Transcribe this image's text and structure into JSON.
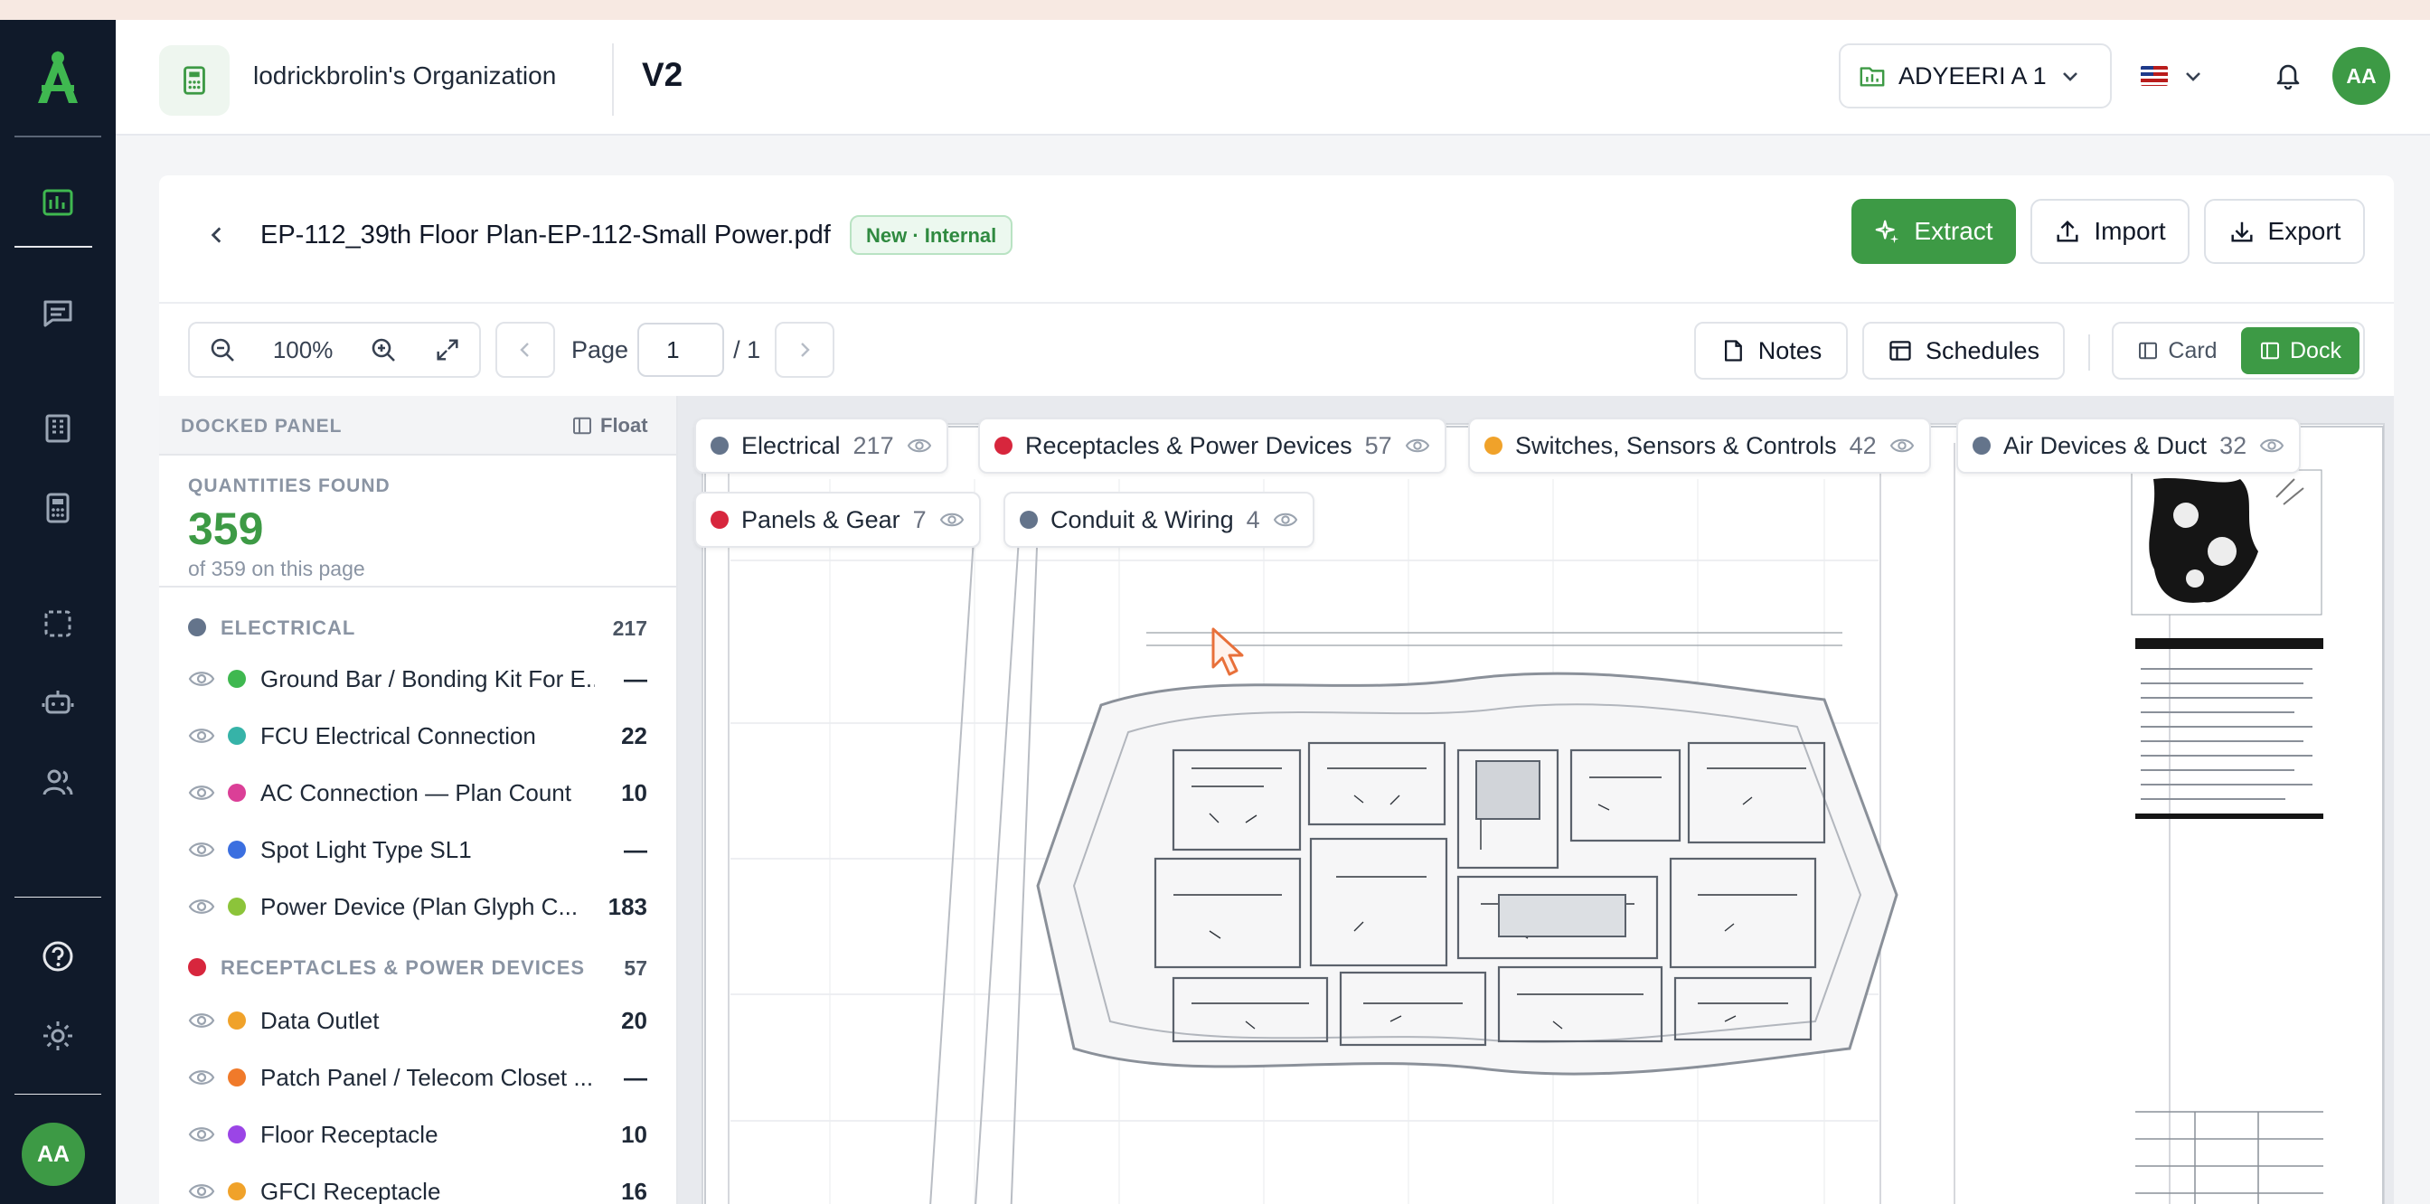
{
  "header": {
    "org_name": "lodrickbrolin's Organization",
    "version": "V2",
    "project": "ADYEERI A 1",
    "avatar": "AA"
  },
  "sidebar": {
    "avatar": "AA",
    "icons": [
      "app-logo-icon",
      "plans-icon",
      "messages-icon",
      "buildings-icon",
      "calculator-icon",
      "selection-icon",
      "robot-icon",
      "team-icon",
      "help-icon",
      "settings-icon"
    ]
  },
  "file": {
    "name": "EP-112_39th Floor Plan-EP-112-Small Power.pdf",
    "badge": "New · Internal",
    "extract": "Extract",
    "import": "Import",
    "export": "Export"
  },
  "toolbar": {
    "zoom": "100%",
    "page_label": "Page",
    "page_value": "1",
    "page_total": "/ 1",
    "notes": "Notes",
    "schedules": "Schedules",
    "card": "Card",
    "dock": "Dock"
  },
  "panel": {
    "title": "DOCKED PANEL",
    "float": "Float",
    "quantities_label": "QUANTITIES FOUND",
    "quantities_total": "359",
    "quantities_sub": "of 359 on this page",
    "categories": [
      {
        "name": "ELECTRICAL",
        "count": "217",
        "color": "#64748b",
        "items": [
          {
            "label": "Ground Bar / Bonding Kit For E...",
            "value": "—",
            "color": "#3fb850"
          },
          {
            "label": "FCU Electrical Connection",
            "value": "22",
            "color": "#36b3a8"
          },
          {
            "label": "AC Connection — Plan Count",
            "value": "10",
            "color": "#db3f97"
          },
          {
            "label": "Spot Light Type SL1",
            "value": "—",
            "color": "#3b6fe0"
          },
          {
            "label": "Power Device (Plan Glyph C...",
            "value": "183",
            "color": "#8cc43a"
          }
        ]
      },
      {
        "name": "RECEPTACLES & POWER DEVICES",
        "count": "57",
        "color": "#d7263d",
        "items": [
          {
            "label": "Data Outlet",
            "value": "20",
            "color": "#f0a22a"
          },
          {
            "label": "Patch Panel / Telecom Closet ...",
            "value": "—",
            "color": "#f07a2a"
          },
          {
            "label": "Floor Receptacle",
            "value": "10",
            "color": "#9b45e6"
          },
          {
            "label": "GFCI Receptacle",
            "value": "16",
            "color": "#f0a22a"
          }
        ]
      }
    ]
  },
  "chips": [
    {
      "name": "Electrical",
      "count": "217",
      "color": "#64748b"
    },
    {
      "name": "Receptacles & Power Devices",
      "count": "57",
      "color": "#d7263d"
    },
    {
      "name": "Switches, Sensors & Controls",
      "count": "42",
      "color": "#f0a22a"
    },
    {
      "name": "Air Devices & Duct",
      "count": "32",
      "color": "#64748b"
    },
    {
      "name": "Panels & Gear",
      "count": "7",
      "color": "#d7263d"
    },
    {
      "name": "Conduit & Wiring",
      "count": "4",
      "color": "#64748b"
    }
  ],
  "colors": {
    "brand": "#3d9a45",
    "rail": "#101a2a"
  }
}
